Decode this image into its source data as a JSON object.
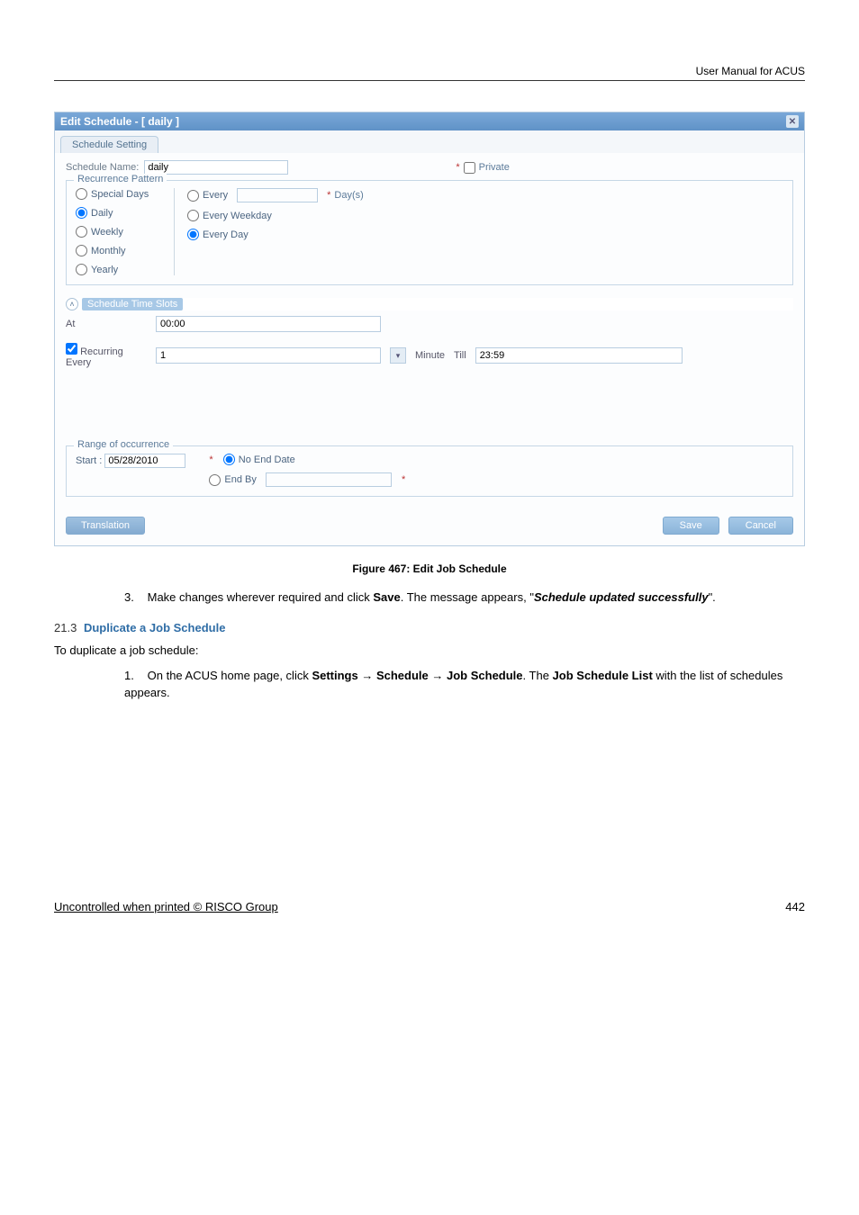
{
  "header": {
    "title": "User Manual for ACUS"
  },
  "dialog": {
    "title": "Edit Schedule - [ daily ]",
    "tab": "Schedule Setting",
    "nameLabel": "Schedule Name:",
    "nameValue": "daily",
    "privateLabel": "Private",
    "recurrence": {
      "legend": "Recurrence Pattern",
      "left": {
        "special": "Special Days",
        "daily": "Daily",
        "weekly": "Weekly",
        "monthly": "Monthly",
        "yearly": "Yearly"
      },
      "right": {
        "every": "Every",
        "days": "Day(s)",
        "everyWeekday": "Every Weekday",
        "everyDay": "Every Day"
      }
    },
    "slots": {
      "header": "Schedule Time Slots",
      "atLabel": "At",
      "atValue": "00:00",
      "recurLabel": "Recurring Every",
      "recurValue": "1",
      "minuteLabel": "Minute",
      "tillLabel": "Till",
      "tillValue": "23:59"
    },
    "range": {
      "legend": "Range of occurrence",
      "startLabel": "Start :",
      "startValue": "05/28/2010",
      "noEnd": "No End Date",
      "endBy": "End By"
    },
    "footer": {
      "translation": "Translation",
      "save": "Save",
      "cancel": "Cancel"
    }
  },
  "figcap": "Figure 467: Edit Job Schedule",
  "step3": {
    "num": "3.",
    "p1a": "Make changes wherever required and click ",
    "p1b": "Save",
    "p1c": ". The message appears, \"",
    "p1d": "Schedule updated successfully",
    "p1e": "\"."
  },
  "section": {
    "no": "21.3",
    "title": "Duplicate a Job Schedule"
  },
  "intro": "To duplicate a job schedule:",
  "step1": {
    "num": "1.",
    "a": "On the ACUS home page, click ",
    "b": "Settings",
    "ar": " → ",
    "c": "Schedule",
    "d": "Job Schedule",
    "e": ". The ",
    "f": "Job Schedule List",
    "g": " with the list of schedules appears."
  },
  "footer": {
    "left": "Uncontrolled when printed © RISCO Group",
    "right": "442"
  }
}
